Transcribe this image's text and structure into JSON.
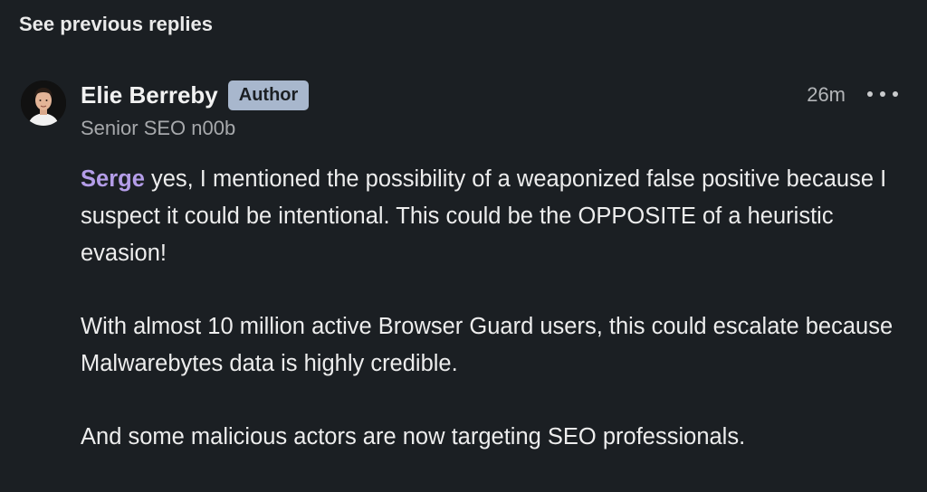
{
  "thread": {
    "see_previous_label": "See previous replies"
  },
  "comment": {
    "author": {
      "name": "Elie Berreby",
      "badge": "Author",
      "headline": "Senior SEO n00b"
    },
    "timestamp": "26m",
    "more_icon": "more-horizontal-icon",
    "mention": "Serge",
    "paragraphs": [
      " yes, I mentioned the possibility of a weaponized false positive because I suspect it could be intentional. This could be the OPPOSITE of a heuristic evasion!",
      "With almost 10 million active Browser Guard users, this could escalate because Malwarebytes data is highly credible.",
      "And some malicious actors are now targeting SEO professionals."
    ]
  },
  "colors": {
    "background": "#1b1f23",
    "badge_bg": "#a8b7cd",
    "mention": "#b49de8",
    "secondary_text": "#a7a9ac"
  }
}
